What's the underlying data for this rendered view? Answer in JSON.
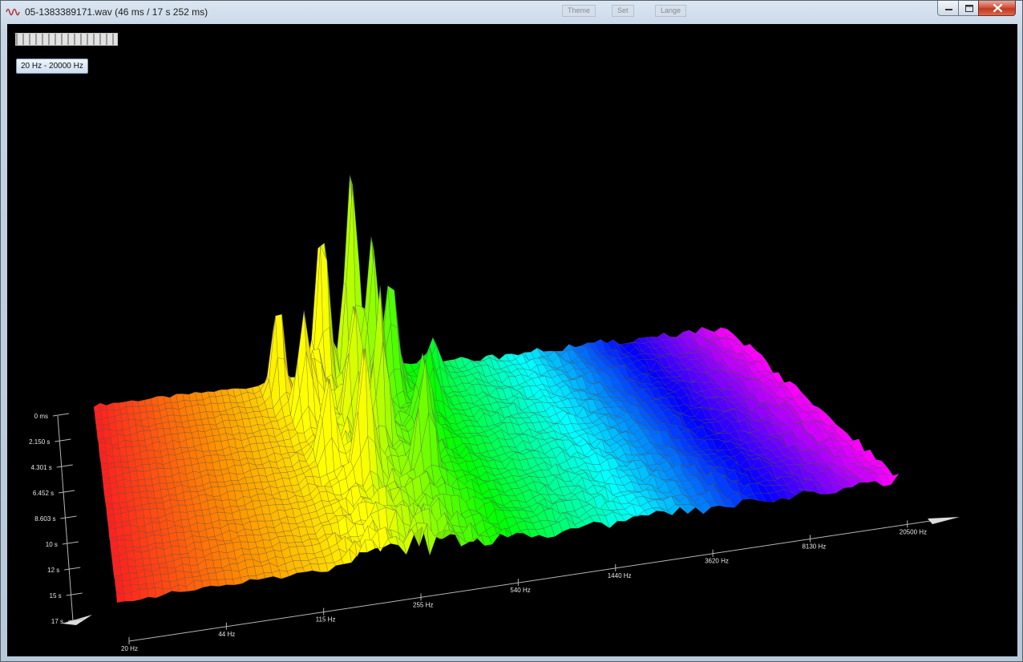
{
  "window": {
    "title": "05-1383389171.wav (46 ms / 17 s 252 ms)",
    "icon": "waveform-icon",
    "background_toolbar": [
      "Theme",
      "Set",
      "Lange"
    ]
  },
  "controls": {
    "scale_bar": "zoom-slider",
    "range_button_label": "20 Hz - 20000 Hz"
  },
  "chart_data": {
    "type": "3d-surface",
    "x_axis": {
      "ticks": [
        "20 Hz",
        "44 Hz",
        "115 Hz",
        "255 Hz",
        "540 Hz",
        "1440 Hz",
        "3620 Hz",
        "8130 Hz",
        "20500 Hz"
      ]
    },
    "y_axis": {
      "ticks": [
        "0 ms",
        "2.150 s",
        "4.301 s",
        "6.452 s",
        "8.603 s",
        "10 s",
        "12 s",
        "15 s",
        "17 s"
      ]
    },
    "color_map": [
      "#ff1e1e",
      "#ff8c00",
      "#ffff00",
      "#00ff00",
      "#00ffff",
      "#0000ff",
      "#ff00ff"
    ],
    "surface": {
      "base_level": 0.02,
      "peaks": [
        {
          "f": 0.285,
          "t": 0.06,
          "h": 0.42
        },
        {
          "f": 0.31,
          "t": 0.2,
          "h": 0.44
        },
        {
          "f": 0.32,
          "t": 0.45,
          "h": 0.36
        },
        {
          "f": 0.335,
          "t": 0.15,
          "h": 0.26
        },
        {
          "f": 0.355,
          "t": 0.05,
          "h": 0.78
        },
        {
          "f": 0.36,
          "t": 0.55,
          "h": 0.48
        },
        {
          "f": 0.38,
          "t": 0.25,
          "h": 0.52
        },
        {
          "f": 0.4,
          "t": 0.05,
          "h": 1.0
        },
        {
          "f": 0.4,
          "t": 0.4,
          "h": 0.62
        },
        {
          "f": 0.42,
          "t": 0.15,
          "h": 0.7
        },
        {
          "f": 0.44,
          "t": 0.6,
          "h": 0.4
        },
        {
          "f": 0.455,
          "t": 0.1,
          "h": 0.5
        },
        {
          "f": 0.47,
          "t": 0.35,
          "h": 0.32
        },
        {
          "f": 0.5,
          "t": 0.2,
          "h": 0.24
        },
        {
          "f": 0.53,
          "t": 0.05,
          "h": 0.16
        }
      ]
    }
  }
}
